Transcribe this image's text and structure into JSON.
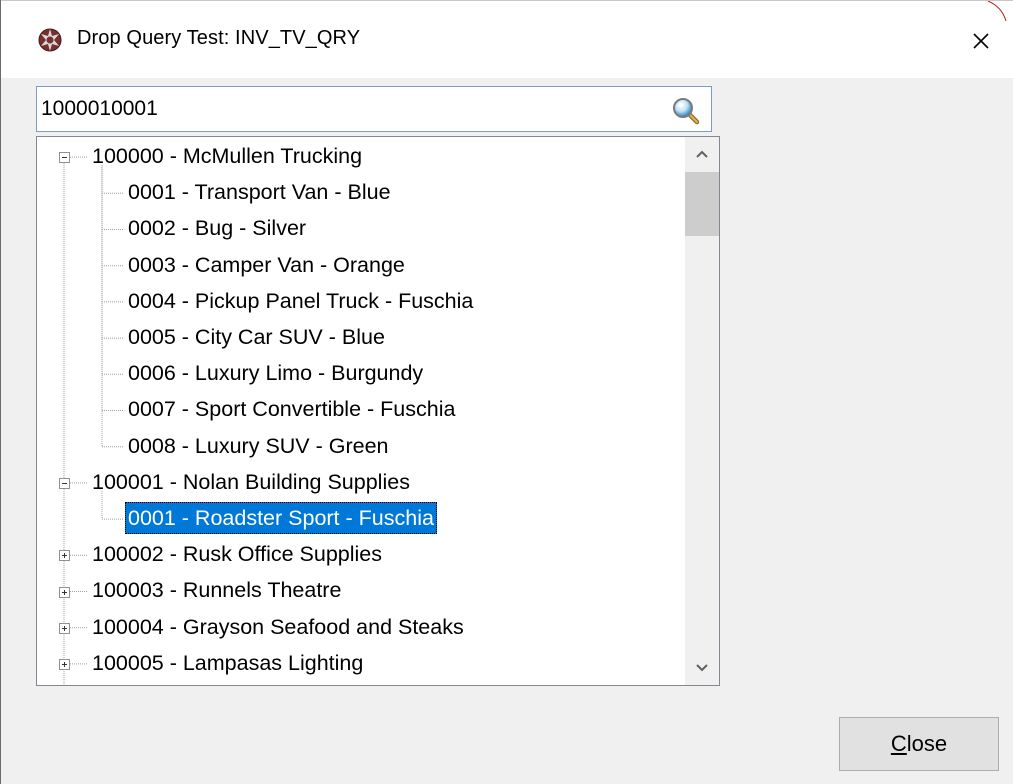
{
  "window": {
    "title": "Drop Query Test: INV_TV_QRY",
    "app_icon": "app-gear-icon",
    "close_icon": "close-icon"
  },
  "search": {
    "value": "1000010001",
    "icon": "search-magnifier-icon"
  },
  "tree": {
    "nodes": [
      {
        "label": "100000 - McMullen Trucking",
        "level": 0,
        "expanded": true
      },
      {
        "label": "0001 - Transport Van - Blue",
        "level": 1
      },
      {
        "label": "0002 - Bug - Silver",
        "level": 1
      },
      {
        "label": "0003 - Camper Van - Orange",
        "level": 1
      },
      {
        "label": "0004 - Pickup Panel Truck - Fuschia",
        "level": 1
      },
      {
        "label": "0005 - City Car SUV - Blue",
        "level": 1
      },
      {
        "label": "0006 - Luxury Limo - Burgundy",
        "level": 1
      },
      {
        "label": "0007 - Sport Convertible - Fuschia",
        "level": 1
      },
      {
        "label": "0008 - Luxury SUV - Green",
        "level": 1
      },
      {
        "label": "100001 - Nolan Building Supplies",
        "level": 0,
        "expanded": true
      },
      {
        "label": "0001 - Roadster Sport - Fuschia",
        "level": 1,
        "selected": true
      },
      {
        "label": "100002 - Rusk Office Supplies",
        "level": 0,
        "expanded": false
      },
      {
        "label": "100003 - Runnels Theatre",
        "level": 0,
        "expanded": false
      },
      {
        "label": "100004 - Grayson Seafood and Steaks",
        "level": 0,
        "expanded": false
      },
      {
        "label": "100005 - Lampasas Lighting",
        "level": 0,
        "expanded": false
      }
    ],
    "scroll_up_icon": "chevron-up-icon",
    "scroll_down_icon": "chevron-down-icon"
  },
  "buttons": {
    "close_mnemonic": "C",
    "close_rest": "lose"
  },
  "colors": {
    "selection": "#0078d7",
    "selection_text": "#ffffff",
    "search_border": "#7a9cc6"
  }
}
